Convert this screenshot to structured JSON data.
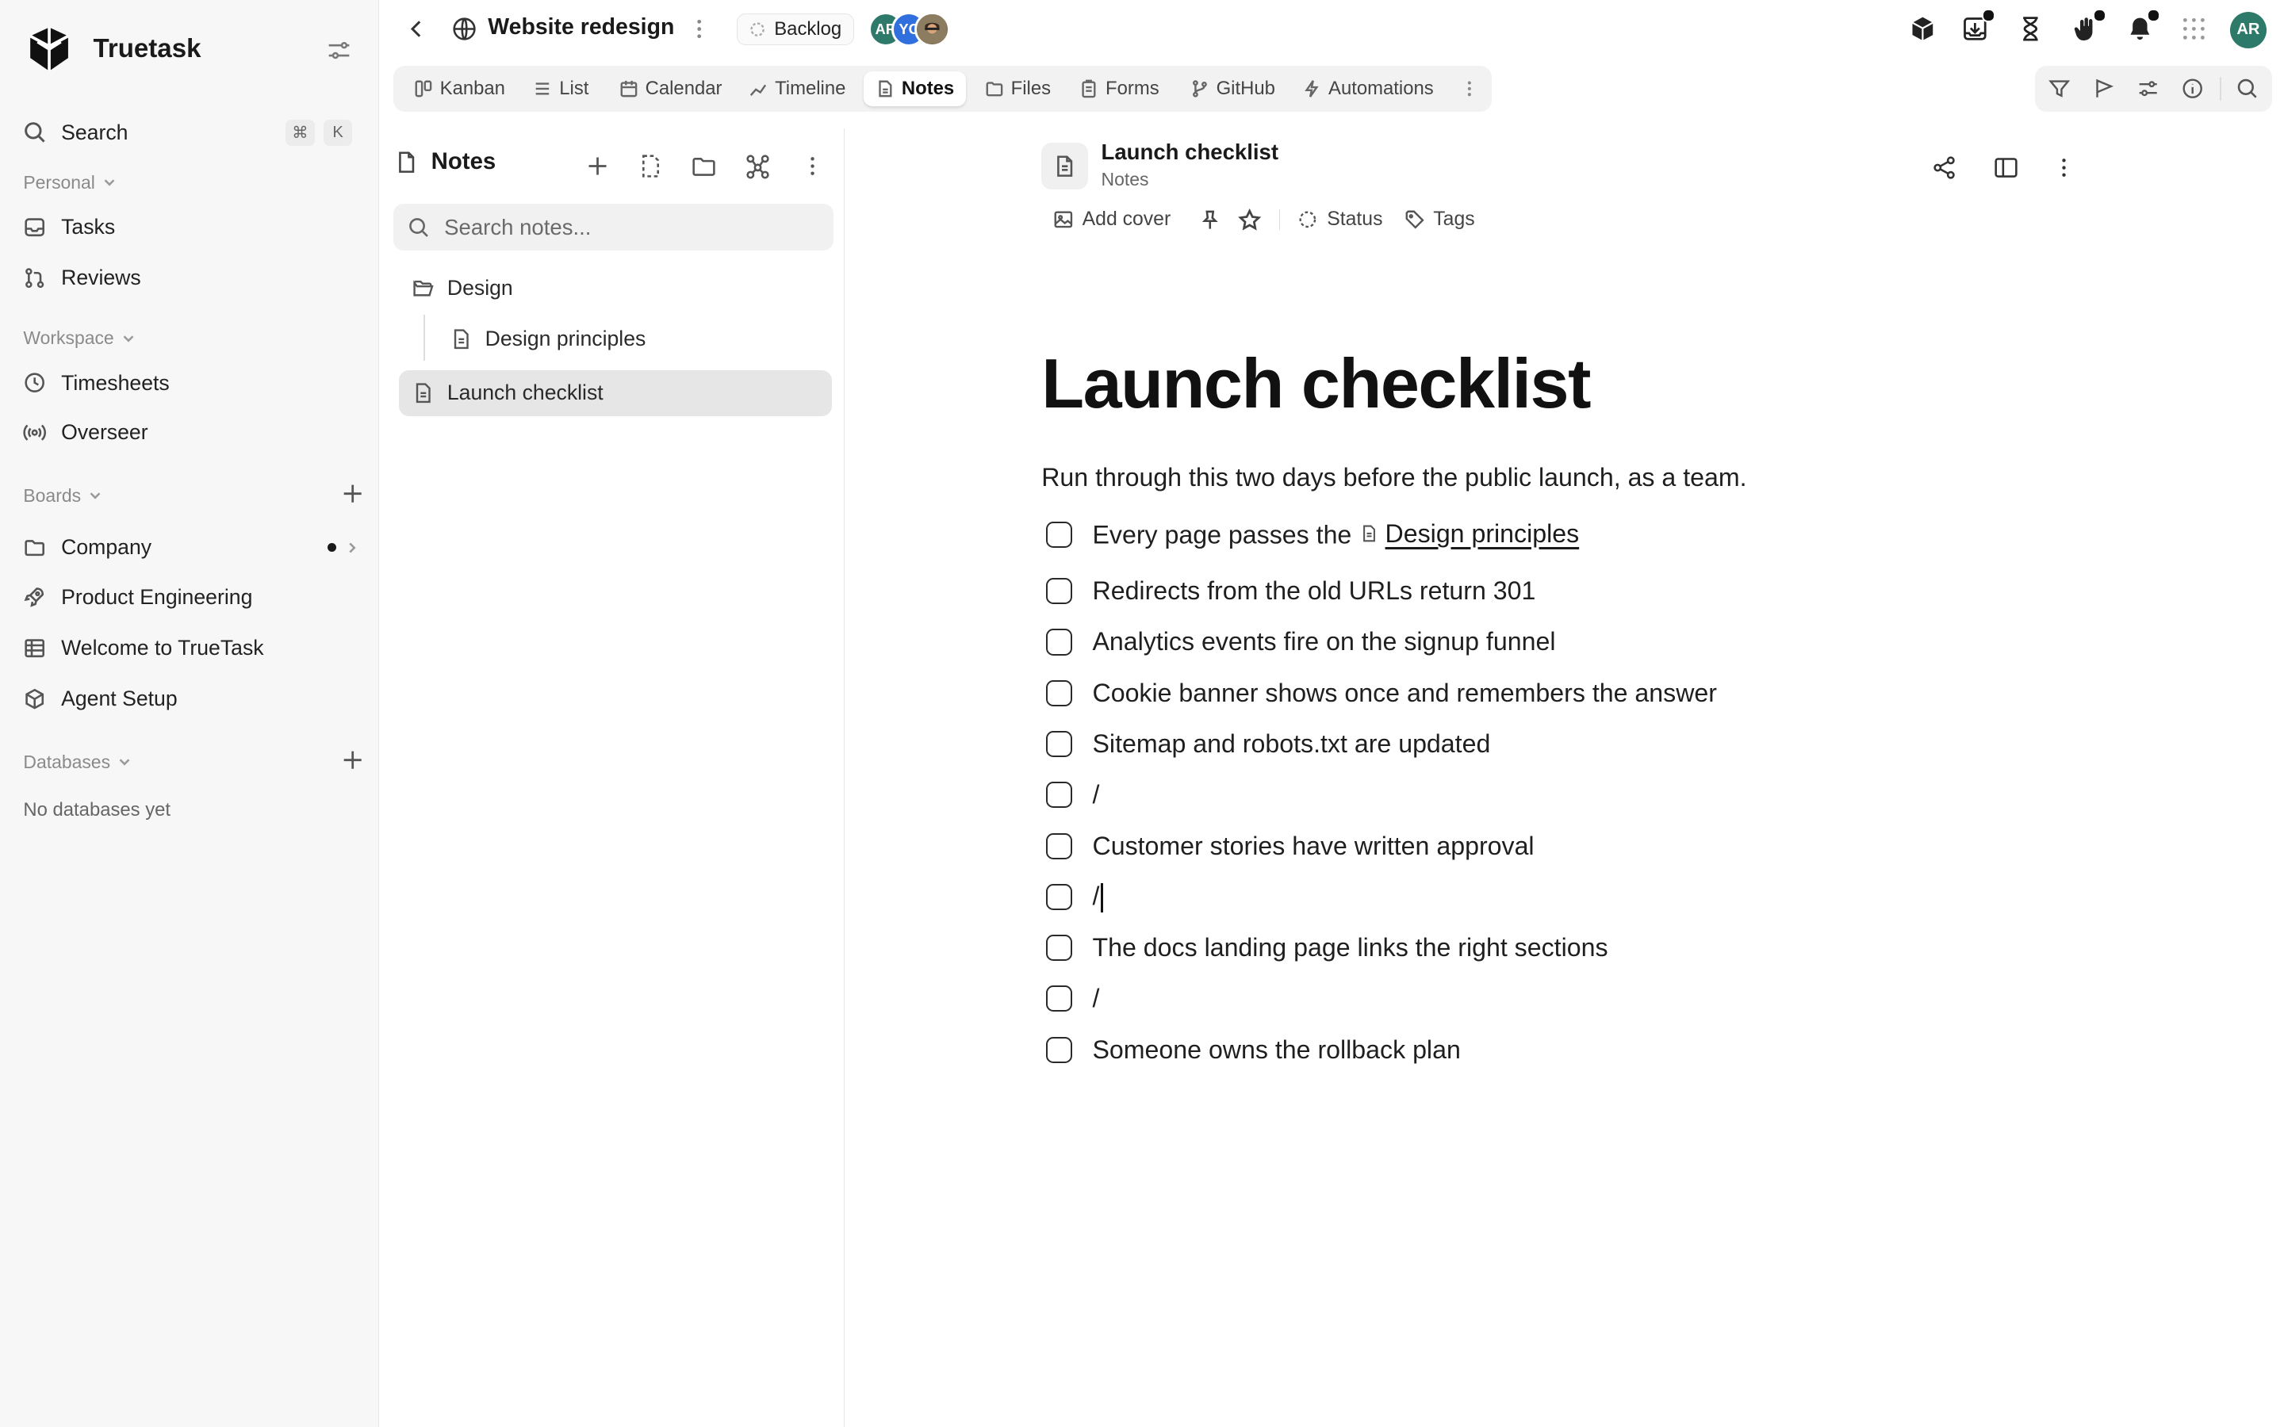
{
  "sidebar": {
    "brand": "Truetask",
    "search_label": "Search",
    "search_shortcut": [
      "⌘",
      "K"
    ],
    "personal_label": "Personal",
    "personal_items": [
      "Tasks",
      "Reviews"
    ],
    "workspace_label": "Workspace",
    "workspace_items": [
      "Timesheets",
      "Overseer"
    ],
    "boards_label": "Boards",
    "boards_items": [
      "Company",
      "Product Engineering",
      "Welcome to TrueTask",
      "Agent Setup"
    ],
    "databases_label": "Databases",
    "databases_empty": "No databases yet"
  },
  "header": {
    "project_title": "Website redesign",
    "status": "Backlog",
    "avatars": [
      {
        "initials": "AR",
        "color": "#2d7a6a"
      },
      {
        "initials": "YC",
        "color": "#2f6fde"
      },
      {
        "initials": "",
        "color": "#7a6a55"
      }
    ],
    "user_initials": "AR"
  },
  "tabs": [
    "Kanban",
    "List",
    "Calendar",
    "Timeline",
    "Notes",
    "Files",
    "Forms",
    "GitHub",
    "Automations"
  ],
  "active_tab": "Notes",
  "notes_panel": {
    "title": "Notes",
    "search_placeholder": "Search notes...",
    "tree": {
      "folder": "Design",
      "folder_child": "Design principles",
      "selected_note": "Launch checklist"
    }
  },
  "document": {
    "crumb_title": "Launch checklist",
    "crumb_sub": "Notes",
    "meta": {
      "add_cover": "Add cover",
      "status": "Status",
      "tags": "Tags"
    },
    "title": "Launch checklist",
    "intro": "Run through this two days before the public launch, as a team.",
    "checklist": [
      {
        "text": "Every page passes the",
        "link": "Design principles",
        "checked": false
      },
      {
        "text": "Redirects from the old URLs return 301",
        "checked": false
      },
      {
        "text": "Analytics events fire on the signup funnel",
        "checked": false
      },
      {
        "text": "Cookie banner shows once and remembers the answer",
        "checked": false
      },
      {
        "text": "Sitemap and robots.txt are updated",
        "checked": false
      },
      {
        "text": "/",
        "checked": false
      },
      {
        "text": "Customer stories have written approval",
        "checked": false
      },
      {
        "text": "/",
        "checked": false
      },
      {
        "text": "The docs landing page links the right sections",
        "checked": false
      },
      {
        "text": "/",
        "checked": false
      },
      {
        "text": "Someone owns the rollback plan",
        "checked": false
      }
    ]
  },
  "colors": {
    "accent": "#2d7a6a",
    "sidebar_bg": "#f7f7f7",
    "selected_bg": "#e6e6e6"
  }
}
